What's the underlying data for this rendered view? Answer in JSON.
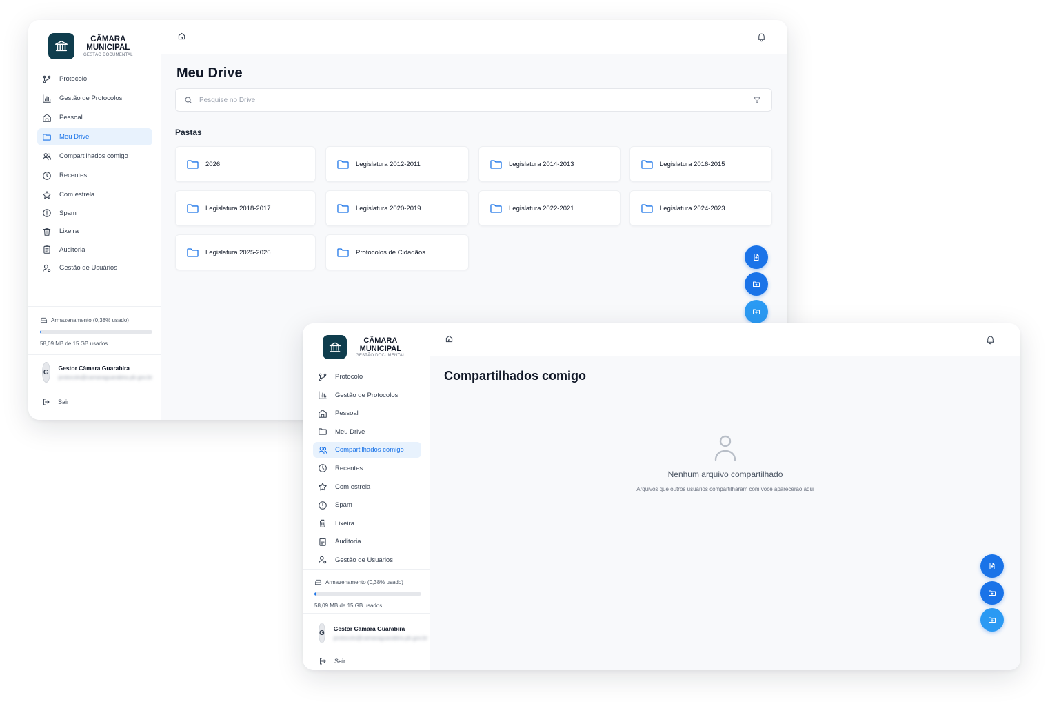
{
  "brand": {
    "title_line1": "CÂMARA",
    "title_line2": "MUNICIPAL",
    "subtitle": "GESTÃO DOCUMENTAL"
  },
  "nav": {
    "items": [
      {
        "label": "Protocolo",
        "icon": "git-branch-icon"
      },
      {
        "label": "Gestão de Protocolos",
        "icon": "bar-chart-icon"
      },
      {
        "label": "Pessoal",
        "icon": "home-icon"
      },
      {
        "label": "Meu Drive",
        "icon": "folder-icon"
      },
      {
        "label": "Compartilhados comigo",
        "icon": "users-icon"
      },
      {
        "label": "Recentes",
        "icon": "clock-icon"
      },
      {
        "label": "Com estrela",
        "icon": "star-icon"
      },
      {
        "label": "Spam",
        "icon": "alert-circle-icon"
      },
      {
        "label": "Lixeira",
        "icon": "trash-icon"
      },
      {
        "label": "Auditoria",
        "icon": "clipboard-icon"
      },
      {
        "label": "Gestão de Usuários",
        "icon": "user-cog-icon"
      }
    ]
  },
  "storage": {
    "label": "Armazenamento (0,38% usado)",
    "used_text": "58,09 MB de 15 GB usados",
    "percent": 0.38
  },
  "user": {
    "initial": "G",
    "name": "Gestor Câmara Guarabira",
    "email": "protocolo@camaraguarabira.pb.gov.br"
  },
  "logout_label": "Sair",
  "drive": {
    "title": "Meu Drive",
    "search_placeholder": "Pesquise no Drive",
    "folders_label": "Pastas",
    "folders": [
      "2026",
      "Legislatura 2012-2011",
      "Legislatura 2014-2013",
      "Legislatura 2016-2015",
      "Legislatura 2018-2017",
      "Legislatura 2020-2019",
      "Legislatura 2022-2021",
      "Legislatura 2024-2023",
      "Legislatura 2025-2026",
      "Protocolos de Cidadãos"
    ]
  },
  "shared": {
    "title": "Compartilhados comigo",
    "empty_title": "Nenhum arquivo compartilhado",
    "empty_desc": "Arquivos que outros usuários compartilharam com você aparecerão aqui"
  },
  "colors": {
    "accent": "#1a73e8",
    "accent_light": "#2b9af3",
    "active_bg": "#e8f2fd",
    "brand_logo_bg": "#0f3d4d"
  }
}
